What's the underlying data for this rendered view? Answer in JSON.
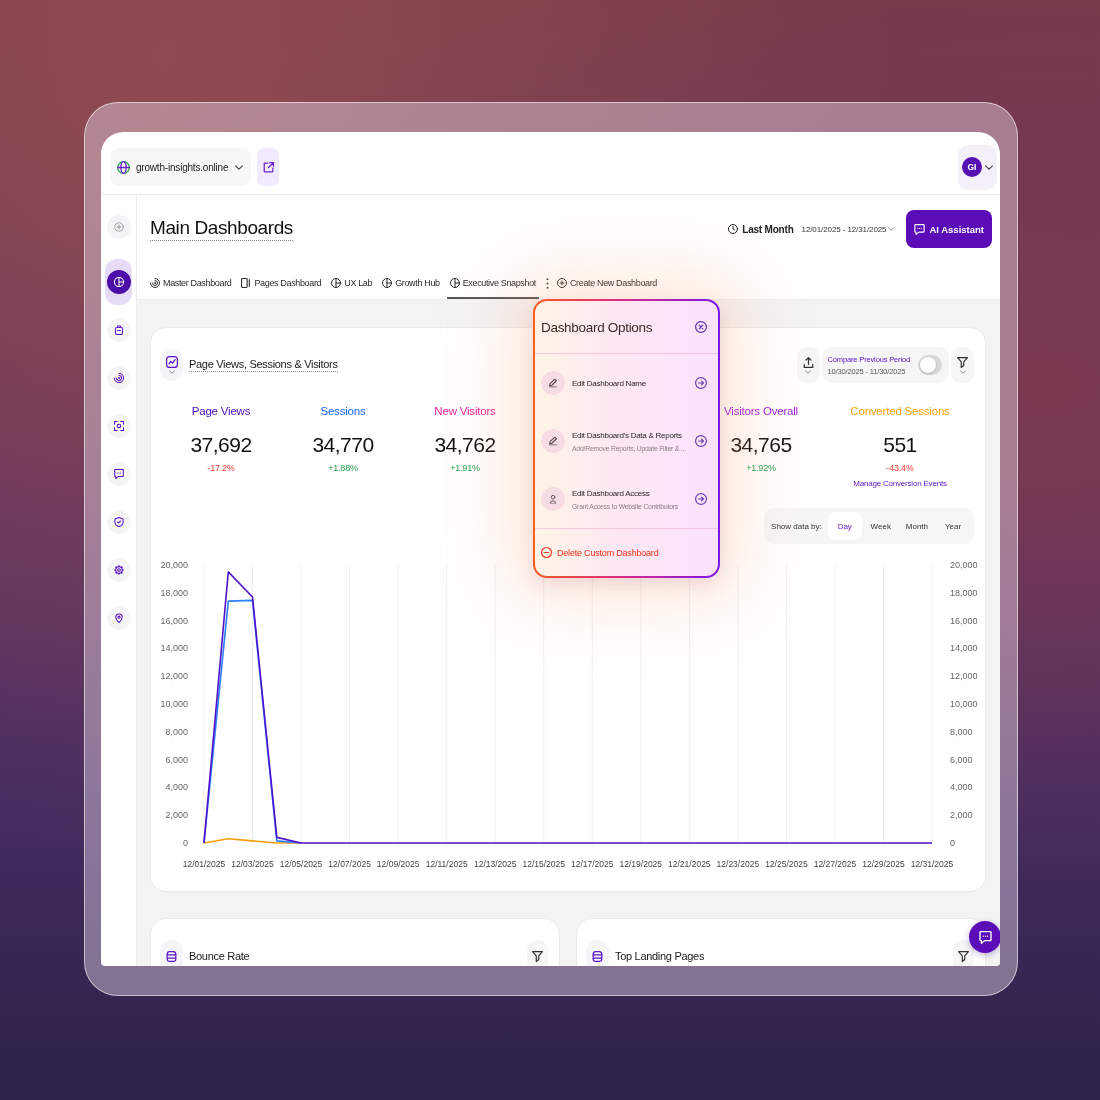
{
  "top_bar": {
    "site": "growth-insights.online",
    "avatar_initials": "GI"
  },
  "sidebar": {
    "items": [
      {
        "selected": true
      },
      {
        "selected": false
      },
      {
        "selected": false
      },
      {
        "selected": false
      },
      {
        "selected": false
      },
      {
        "selected": false
      },
      {
        "selected": false
      },
      {
        "selected": false
      }
    ]
  },
  "header": {
    "title": "Main Dashboards",
    "period": "Last Month",
    "date_range": "12/01/2025 - 12/31/2025",
    "assistant_button": "AI Assistant"
  },
  "tabs": [
    {
      "label": "Master Dashboard",
      "selected": false
    },
    {
      "label": "Pages Dashboard",
      "selected": false
    },
    {
      "label": "UX Lab",
      "selected": false
    },
    {
      "label": "Growth Hub",
      "selected": false
    },
    {
      "label": "Executive Snapshot",
      "selected": true
    }
  ],
  "create_dashboard_button": "Create New Dashboard",
  "dashboard_options": {
    "title": "Dashboard Options",
    "items": [
      {
        "label": "Edit Dashboard Name"
      },
      {
        "label": "Edit Dashboard's Data & Reports",
        "description": "Add/Remove Reports, Update Filter & ..."
      },
      {
        "label": "Edit Dashboard Access",
        "description": "Grant Access to Website Contributors"
      }
    ],
    "delete_button": "Delete Custom Dashboard"
  },
  "traffic_card": {
    "title": "Page Views, Sessions & Visitors",
    "compare": {
      "label": "Compare Previous Period",
      "range": "10/30/2025 - 11/30/2025",
      "on": false
    },
    "metrics": [
      {
        "label": "Page Views",
        "color": "#4a0fb8",
        "value": "37,692",
        "change": "-17.2%",
        "negative": true
      },
      {
        "label": "Sessions",
        "color": "#1763f3",
        "value": "34,770",
        "change": "+1.88%",
        "negative": false
      },
      {
        "label": "New Visitors",
        "color": "#e8249c",
        "value": "34,762",
        "change": "+1.91%",
        "negative": false
      },
      {
        "label": "Visitors Overall",
        "color": "#9a1de0",
        "value": "34,765",
        "change": "+1.92%",
        "negative": false
      },
      {
        "label": "Converted Sessions",
        "color": "#f5a10c",
        "value": "551",
        "change": "-43.4%",
        "negative": true,
        "link": "Manage Conversion Events"
      }
    ],
    "show_by": {
      "label": "Show data by:",
      "options": [
        {
          "label": "Day",
          "selected": true
        },
        {
          "label": "Week",
          "selected": false
        },
        {
          "label": "Month",
          "selected": false
        },
        {
          "label": "Year",
          "selected": false
        }
      ]
    },
    "chart_data": {
      "type": "line",
      "grid": true,
      "categories": [
        "12/01/2025",
        null,
        "12/03/2025",
        null,
        "12/05/2025",
        null,
        "12/07/2025",
        null,
        "12/09/2025",
        null,
        "12/11/2025",
        null,
        "12/13/2025",
        null,
        "12/15/2025",
        null,
        "12/17/2025",
        null,
        "12/19/2025",
        null,
        "12/21/2025",
        null,
        "12/23/2025",
        null,
        "12/25/2025",
        null,
        "12/27/2025",
        null,
        "12/29/2025",
        null,
        "12/31/2025"
      ],
      "ylim": [
        0,
        20000
      ],
      "yticks": [
        {
          "value": 0,
          "label": "0"
        },
        {
          "value": 2000,
          "label": "2,000"
        },
        {
          "value": 4000,
          "label": "4,000"
        },
        {
          "value": 6000,
          "label": "6,000"
        },
        {
          "value": 8000,
          "label": "8,000"
        },
        {
          "value": 10000,
          "label": "10,000"
        },
        {
          "value": 12000,
          "label": "12,000"
        },
        {
          "value": 14000,
          "label": "14,000"
        },
        {
          "value": 16000,
          "label": "16,000"
        },
        {
          "value": 18000,
          "label": "18,000"
        },
        {
          "value": 20000,
          "label": "20,000"
        }
      ],
      "y2lim": [
        0,
        20000
      ],
      "y2ticks": [
        {
          "value": 0,
          "label": "0"
        },
        {
          "value": 2000,
          "label": "2,000"
        },
        {
          "value": 4000,
          "label": "4,000"
        },
        {
          "value": 6000,
          "label": "6,000"
        },
        {
          "value": 8000,
          "label": "8,000"
        },
        {
          "value": 10000,
          "label": "10,000"
        },
        {
          "value": 12000,
          "label": "12,000"
        },
        {
          "value": 14000,
          "label": "14,000"
        },
        {
          "value": 16000,
          "label": "16,000"
        },
        {
          "value": 18000,
          "label": "18,000"
        },
        {
          "value": 20000,
          "label": "20,000"
        }
      ],
      "series": [
        {
          "color": "#4f12c9",
          "values": [
            0,
            19500,
            17700,
            400,
            0,
            0,
            0,
            0,
            0,
            0,
            0,
            0,
            0,
            0,
            0,
            0,
            0,
            0,
            0,
            0,
            0,
            0,
            0,
            0,
            0,
            0,
            0,
            0,
            0,
            0,
            0
          ]
        },
        {
          "color": "#2b7fff",
          "values": [
            0,
            17400,
            17450,
            150,
            0,
            null,
            null,
            null,
            null,
            null,
            null,
            null,
            null,
            null,
            null,
            null,
            null,
            null,
            null,
            null,
            null,
            null,
            null,
            null,
            null,
            null,
            null,
            null,
            null,
            null,
            null
          ]
        },
        {
          "color": "#f59e0b",
          "values": [
            0,
            300,
            150,
            0,
            0,
            null,
            null,
            null,
            null,
            null,
            null,
            null,
            null,
            null,
            null,
            null,
            null,
            null,
            null,
            null,
            null,
            null,
            null,
            null,
            null,
            null,
            null,
            null,
            null,
            null,
            null
          ]
        }
      ]
    }
  },
  "bottom_cards": [
    {
      "title": "Bounce Rate"
    },
    {
      "title": "Top Landing Pages"
    }
  ]
}
